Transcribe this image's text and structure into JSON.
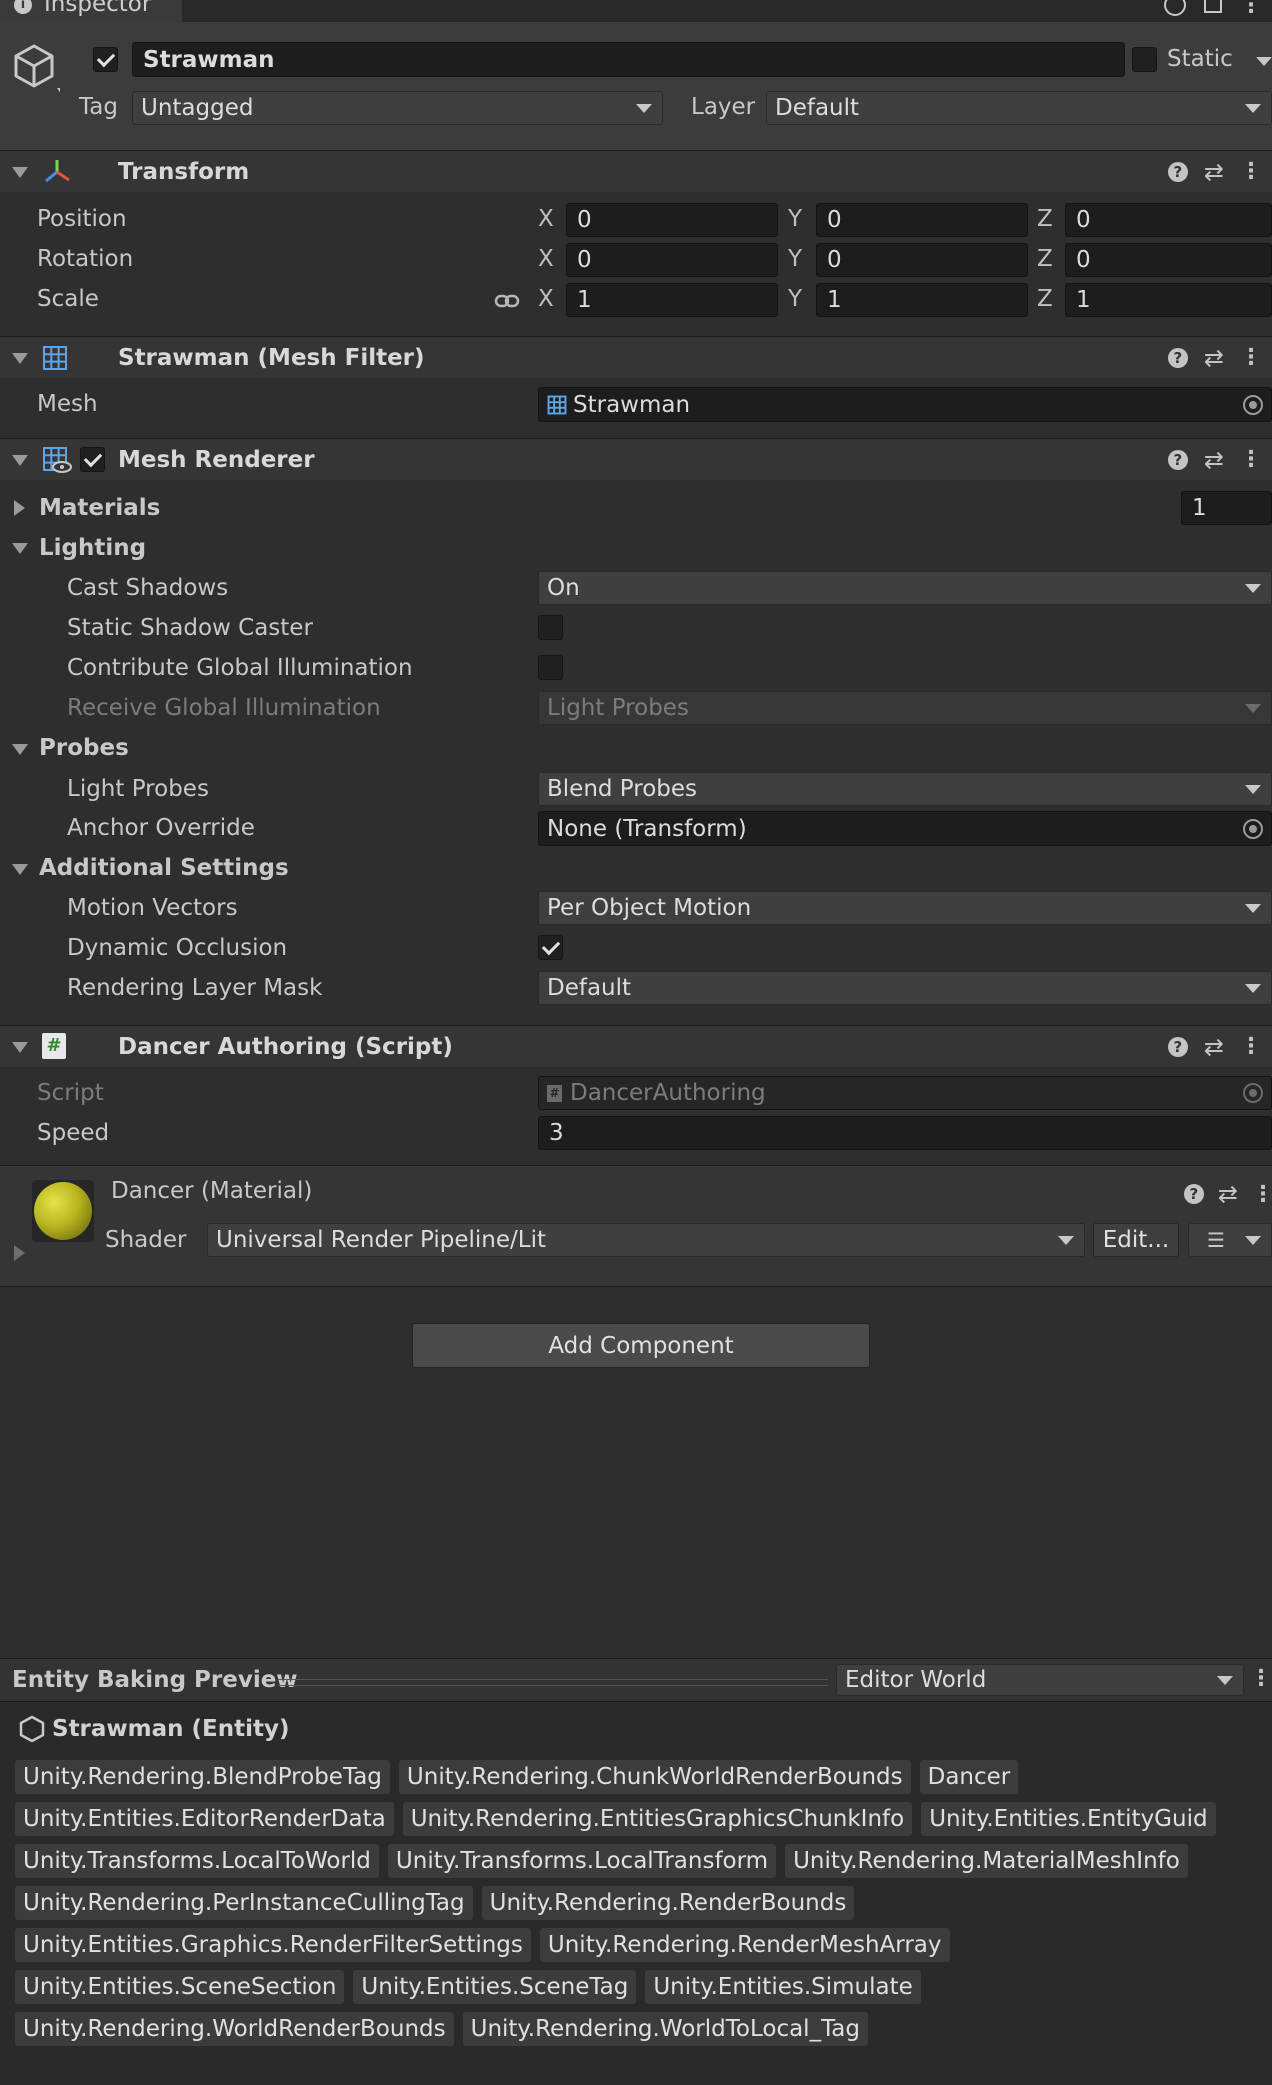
{
  "inspector": {
    "tab_title": "Inspector",
    "object_name": "Strawman",
    "object_active": true,
    "static_label": "Static",
    "tag_label": "Tag",
    "tag_value": "Untagged",
    "layer_label": "Layer",
    "layer_value": "Default"
  },
  "transform": {
    "title": "Transform",
    "position_label": "Position",
    "rotation_label": "Rotation",
    "scale_label": "Scale",
    "axis_x": "X",
    "axis_y": "Y",
    "axis_z": "Z",
    "position": {
      "x": "0",
      "y": "0",
      "z": "0"
    },
    "rotation": {
      "x": "0",
      "y": "0",
      "z": "0"
    },
    "scale": {
      "x": "1",
      "y": "1",
      "z": "1"
    }
  },
  "mesh_filter": {
    "title": "Strawman (Mesh Filter)",
    "mesh_label": "Mesh",
    "mesh_value": "Strawman"
  },
  "mesh_renderer": {
    "title": "Mesh Renderer",
    "enabled": true,
    "materials_label": "Materials",
    "materials_count": "1",
    "lighting_label": "Lighting",
    "cast_shadows_label": "Cast Shadows",
    "cast_shadows_value": "On",
    "static_shadow_caster_label": "Static Shadow Caster",
    "contribute_gi_label": "Contribute Global Illumination",
    "receive_gi_label": "Receive Global Illumination",
    "receive_gi_value": "Light Probes",
    "probes_label": "Probes",
    "light_probes_label": "Light Probes",
    "light_probes_value": "Blend Probes",
    "anchor_override_label": "Anchor Override",
    "anchor_override_value": "None (Transform)",
    "additional_settings_label": "Additional Settings",
    "motion_vectors_label": "Motion Vectors",
    "motion_vectors_value": "Per Object Motion",
    "dynamic_occlusion_label": "Dynamic Occlusion",
    "rendering_layer_mask_label": "Rendering Layer Mask",
    "rendering_layer_mask_value": "Default"
  },
  "dancer_authoring": {
    "title": "Dancer Authoring (Script)",
    "script_label": "Script",
    "script_value": "DancerAuthoring",
    "speed_label": "Speed",
    "speed_value": "3"
  },
  "material": {
    "title": "Dancer (Material)",
    "shader_label": "Shader",
    "shader_value": "Universal Render Pipeline/Lit",
    "edit_label": "Edit...",
    "sphere_color": "#b9b51f"
  },
  "add_component_label": "Add Component",
  "baking_preview": {
    "title": "Entity Baking Preview",
    "world_value": "Editor World",
    "entity_name": "Strawman (Entity)",
    "components": [
      "Unity.Rendering.BlendProbeTag",
      "Unity.Rendering.ChunkWorldRenderBounds",
      "Dancer",
      "Unity.Entities.EditorRenderData",
      "Unity.Rendering.EntitiesGraphicsChunkInfo",
      "Unity.Entities.EntityGuid",
      "Unity.Transforms.LocalToWorld",
      "Unity.Transforms.LocalTransform",
      "Unity.Rendering.MaterialMeshInfo",
      "Unity.Rendering.PerInstanceCullingTag",
      "Unity.Rendering.RenderBounds",
      "Unity.Entities.Graphics.RenderFilterSettings",
      "Unity.Rendering.RenderMeshArray",
      "Unity.Entities.SceneSection",
      "Unity.Entities.SceneTag",
      "Unity.Entities.Simulate",
      "Unity.Rendering.WorldRenderBounds",
      "Unity.Rendering.WorldToLocal_Tag"
    ]
  },
  "colors": {
    "background": "#2e2e2e",
    "header": "#353535",
    "field": "#1d1d1d",
    "text": "#d2d2d2"
  }
}
